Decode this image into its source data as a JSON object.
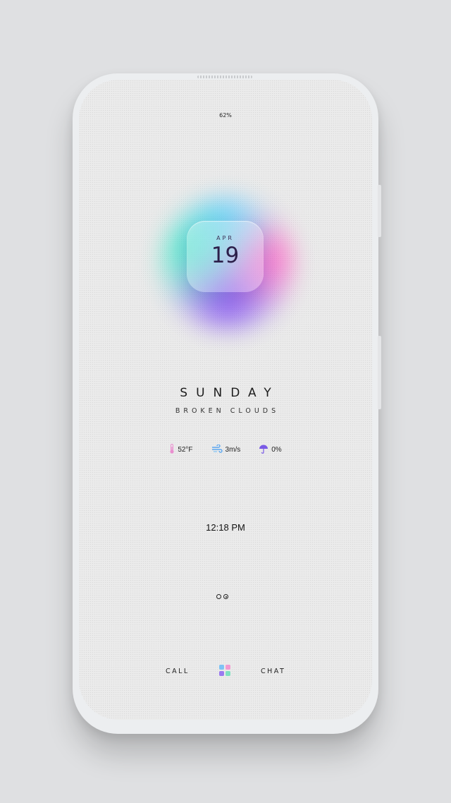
{
  "status_bar": {
    "battery": "62%"
  },
  "date_widget": {
    "month": "APR",
    "day": "19"
  },
  "weather": {
    "weekday": "SUNDAY",
    "condition": "BROKEN CLOUDS",
    "temperature": "52°F",
    "wind": "3m/s",
    "precipitation": "0%"
  },
  "clock": {
    "time": "12:18 PM"
  },
  "pager": {
    "pages": 2,
    "active": 2
  },
  "dock": {
    "left_label": "CALL",
    "right_label": "CHAT"
  },
  "colors": {
    "glow_teal": "#40e6c8",
    "glow_blue": "#5ac8ff",
    "glow_pink": "#ff50be",
    "glow_purple": "#8250f0",
    "thermometer": "#e98fcf",
    "wind": "#5aa6f0",
    "umbrella": "#7a5ae6"
  }
}
